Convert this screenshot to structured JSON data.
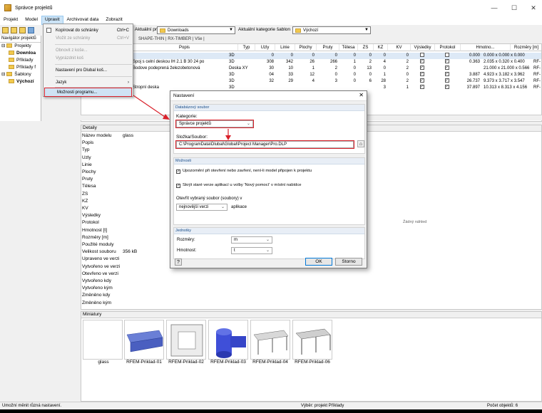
{
  "window": {
    "title": "Správce projektů"
  },
  "menu": [
    "Projekt",
    "Model",
    "Upravit",
    "Archivovat data",
    "Zobrazit"
  ],
  "toolbar": {
    "project_label": "Aktuální projekt:",
    "project_value": "Downloads",
    "category_label": "Aktuální kategorie šablon",
    "category_value": "Výchozí"
  },
  "navigator": {
    "title": "Navigátor projektů",
    "items": [
      "Projekty",
      "Downloa",
      "Příklady",
      "Příklady f",
      "Šablony",
      "Výchozí"
    ]
  },
  "edit_menu": {
    "items": [
      {
        "label": "Kopírovat do schránky",
        "shortcut": "Ctrl+C"
      },
      {
        "label": "Vložit ze schránky",
        "shortcut": "Ctrl+V"
      },
      {
        "label": "Obnovit z koše..."
      },
      {
        "label": "Vyprázdnit koš"
      },
      {
        "label": "Nastavení pro Dlubal koš..."
      },
      {
        "label": "Jazyk",
        "submenu": "›"
      },
      {
        "label": "Možnosti programu..."
      }
    ]
  },
  "tabs_text": "SHAPE-THIN  |  RX-TIMBER  |  Vše  |",
  "grid": {
    "headers": [
      "Popis",
      "Typ",
      "Uzly",
      "Linie",
      "Plochy",
      "Pruty",
      "Tělesa",
      "ZS",
      "KZ",
      "KV",
      "Výsledky",
      "Protokol",
      "Hmotno...",
      "Rozměry [m]"
    ],
    "rows": [
      [
        "",
        "3D",
        "0",
        "0",
        "0",
        "0",
        "0",
        "0",
        "0",
        "0",
        "",
        "",
        "0.000",
        "0.000 x 0.000 x 0.000",
        ""
      ],
      [
        "Spoj s celní deskou IH 2.1 B 30 24 po",
        "3D",
        "308",
        "342",
        "26",
        "266",
        "1",
        "2",
        "4",
        "2",
        "x",
        "x",
        "0.363",
        "2.035 x 0.320 x 0.400",
        "RF-"
      ],
      [
        "Bodove podeprená železobetonová",
        "Deska XY",
        "30",
        "10",
        "1",
        "2",
        "0",
        "13",
        "0",
        "2",
        "x",
        "x",
        "",
        "21.000 x 21.000 x 0.566",
        "RF-"
      ],
      [
        "",
        "3D",
        "04",
        "33",
        "12",
        "0",
        "0",
        "0",
        "1",
        "0",
        "x",
        "x",
        "3.887",
        "4.923 x 3.182 x 3.962",
        "RF-"
      ],
      [
        "",
        "3D",
        "32",
        "29",
        "4",
        "3",
        "0",
        "6",
        "28",
        "2",
        "x",
        "x",
        "26.737",
        "9.373 x 3.717 x 3.547",
        "RF-"
      ],
      [
        "Stropní deska",
        "3D",
        "",
        "",
        "",
        "",
        "",
        "",
        "3",
        "1",
        "x",
        "x",
        "37.897",
        "10.313 x 8.313 x 4.156",
        "RF-"
      ]
    ]
  },
  "details": {
    "title": "Detaily",
    "rows": [
      {
        "label": "Název modelu",
        "value": "glass"
      },
      {
        "label": "Popis",
        "value": ""
      },
      {
        "label": "Typ",
        "value": ""
      },
      {
        "label": "Uzly",
        "value": ""
      },
      {
        "label": "Linie",
        "value": ""
      },
      {
        "label": "Plochy",
        "value": ""
      },
      {
        "label": "Pruty",
        "value": ""
      },
      {
        "label": "Tělesa",
        "value": ""
      },
      {
        "label": "ZS",
        "value": ""
      },
      {
        "label": "KZ",
        "value": ""
      },
      {
        "label": "KV",
        "value": ""
      },
      {
        "label": "Výsledky",
        "value": ""
      },
      {
        "label": "Protokol",
        "value": ""
      },
      {
        "label": "Hmotnost [t]",
        "value": ""
      },
      {
        "label": "Rozměry [m]",
        "value": ""
      },
      {
        "label": "Použité moduly",
        "value": ""
      },
      {
        "label": "Velikost souboru",
        "value": "356 kB"
      },
      {
        "label": "Upraveno ve verzi",
        "value": ""
      },
      {
        "label": "Vytvořeno ve verzi",
        "value": ""
      },
      {
        "label": "Otevřeno ve verzi",
        "value": ""
      },
      {
        "label": "Vytvořeno kdy",
        "value": ""
      },
      {
        "label": "Vytvořeno kým",
        "value": ""
      },
      {
        "label": "Změněno kdy",
        "value": ""
      },
      {
        "label": "Změněno kým",
        "value": ""
      }
    ],
    "no_preview": "Žádný náhled"
  },
  "thumbnails": {
    "title": "Miniatury",
    "items": [
      "glass",
      "RFEM-Priklad-01",
      "RFEM-Priklad-02",
      "RFEM-Priklad-03",
      "RFEM-Priklad-04",
      "RFEM-Priklad-06"
    ]
  },
  "status": {
    "left": "Umožní měnit různá nastavení.",
    "middle": "Výběr: projekt Příklady",
    "right": "Počet objektů: 6"
  },
  "dialog": {
    "title": "Nastavení",
    "db_group": "Databázový soubor",
    "category_label": "Kategorie:",
    "category_value": "Správce projektů",
    "folder_label": "Složka/Soubor:",
    "folder_value": "C:\\ProgramData\\Dlubal\\Global\\Project Manager\\Pro.DLP",
    "options_group": "Možnosti",
    "opt1": "Upozornění při otevření nebo zavření, není-li model připojen k projektu",
    "opt2": "Skrýt staré verze aplikací u volby 'Nový pomocí' v místní nabídce",
    "open_label": "Otevřít vybraný soubor (soubory) v",
    "open_value": "nejnovější verzi",
    "open_suffix": "aplikace",
    "units_group": "Jednotky",
    "dim_label": "Rozměry:",
    "dim_value": "m",
    "mass_label": "Hmotnost:",
    "mass_value": "t",
    "ok": "OK",
    "cancel": "Storno"
  },
  "colors": {
    "highlight": "#d9202a",
    "folder": "#f2c94c"
  }
}
